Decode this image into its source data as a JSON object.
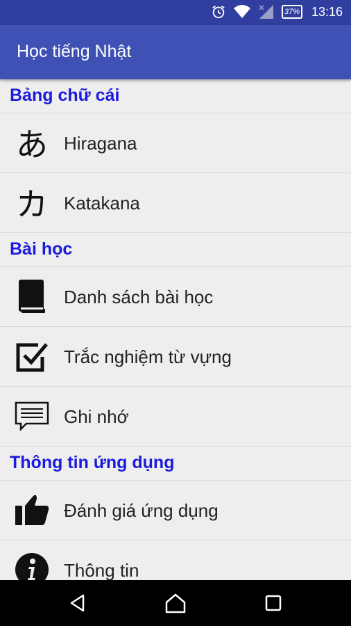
{
  "status": {
    "time": "13:16",
    "battery": "37%"
  },
  "appbar": {
    "title": "Học tiếng Nhật"
  },
  "sections": [
    {
      "title": "Bảng chữ cái"
    },
    {
      "title": "Bài học"
    },
    {
      "title": "Thông tin ứng dụng"
    }
  ],
  "items": [
    {
      "label": "Hiragana",
      "glyph": "あ"
    },
    {
      "label": "Katakana",
      "glyph": "カ"
    },
    {
      "label": "Danh sách bài học"
    },
    {
      "label": "Trắc nghiệm từ vựng"
    },
    {
      "label": "Ghi nhớ"
    },
    {
      "label": "Đánh giá ứng dụng"
    },
    {
      "label": "Thông tin"
    }
  ]
}
